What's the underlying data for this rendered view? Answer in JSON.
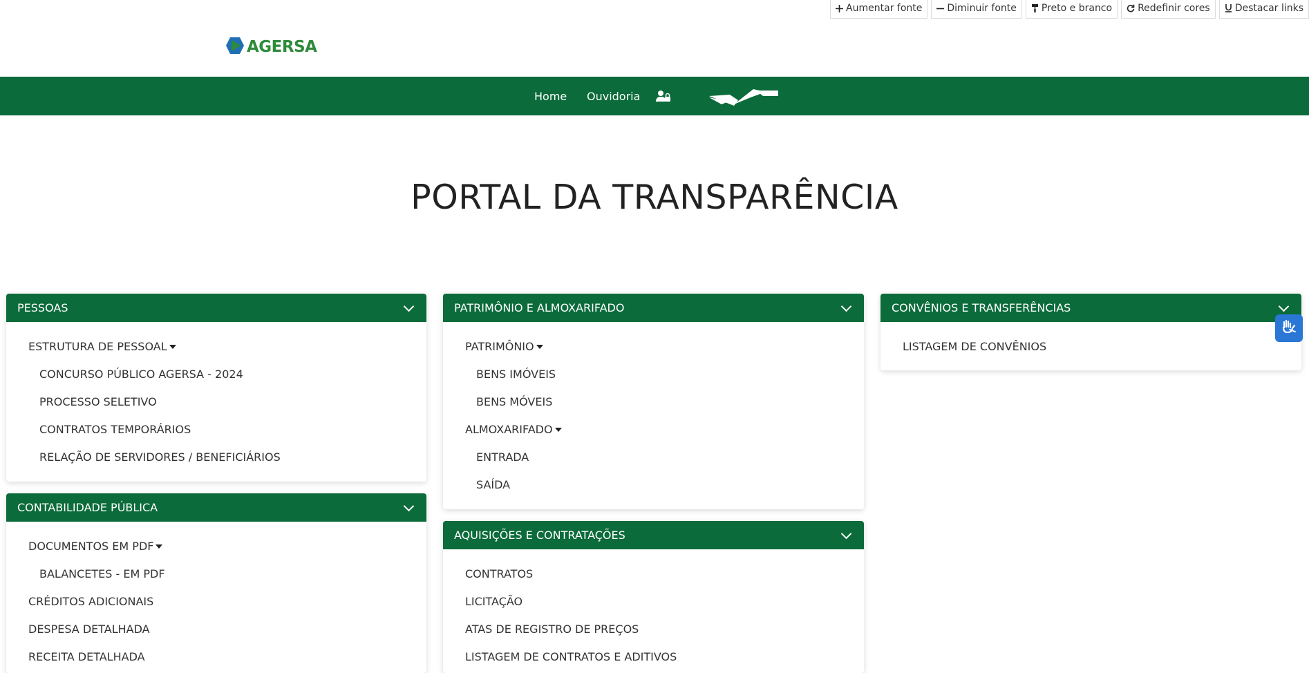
{
  "accessibility_toolbar": {
    "buttons": [
      {
        "icon": "plus-icon",
        "label": "Aumentar fonte"
      },
      {
        "icon": "minus-icon",
        "label": "Diminuir fonte"
      },
      {
        "icon": "paint-roller-icon",
        "label": "Preto e branco"
      },
      {
        "icon": "refresh-icon",
        "label": "Redefinir cores"
      },
      {
        "icon": "underline-icon",
        "label": "Destacar links"
      }
    ]
  },
  "header": {
    "logo_text": "AGERSA"
  },
  "navbar": {
    "items": [
      "Home",
      "Ouvidoria"
    ],
    "icons": [
      "user-lock-icon",
      "handshake-icon"
    ]
  },
  "page_title": "PORTAL DA TRANSPARÊNCIA",
  "cards": {
    "pessoas": {
      "title": "PESSOAS",
      "items": [
        {
          "label": "ESTRUTURA DE PESSOAL",
          "dropdown": true
        },
        {
          "label": "CONCURSO PÚBLICO AGERSA - 2024"
        },
        {
          "label": "PROCESSO SELETIVO"
        },
        {
          "label": "CONTRATOS TEMPORÁRIOS"
        },
        {
          "label": "RELAÇÃO DE SERVIDORES / BENEFICIÁRIOS"
        }
      ]
    },
    "contabilidade": {
      "title": "CONTABILIDADE PÚBLICA",
      "items": [
        {
          "label": "DOCUMENTOS EM PDF",
          "dropdown": true
        },
        {
          "label": "BALANCETES - EM PDF"
        },
        {
          "label": "CRÉDITOS ADICIONAIS"
        },
        {
          "label": "DESPESA DETALHADA"
        },
        {
          "label": "RECEITA DETALHADA"
        }
      ]
    },
    "patrimonio": {
      "title": "PATRIMÔNIO E ALMOXARIFADO",
      "items": [
        {
          "label": "PATRIMÔNIO",
          "dropdown": true
        },
        {
          "label": "BENS IMÓVEIS"
        },
        {
          "label": "BENS MÓVEIS"
        },
        {
          "label": "ALMOXARIFADO",
          "dropdown": true
        },
        {
          "label": "ENTRADA"
        },
        {
          "label": "SAÍDA"
        }
      ]
    },
    "aquisicoes": {
      "title": "AQUISIÇÕES E CONTRATAÇÕES",
      "items": [
        {
          "label": "CONTRATOS"
        },
        {
          "label": "LICITAÇÃO"
        },
        {
          "label": "ATAS DE REGISTRO DE PREÇOS"
        },
        {
          "label": "LISTAGEM DE CONTRATOS E ADITIVOS"
        }
      ]
    },
    "convenios": {
      "title": "CONVÊNIOS E TRANSFERÊNCIAS",
      "items": [
        {
          "label": "LISTAGEM DE CONVÊNIOS"
        }
      ]
    }
  },
  "colors": {
    "brand_green": "#0b6b3a",
    "logo_green": "#2e8b3a",
    "libras_blue": "#2a77d6"
  },
  "floating_widget": {
    "icon": "sign-language-icon"
  }
}
